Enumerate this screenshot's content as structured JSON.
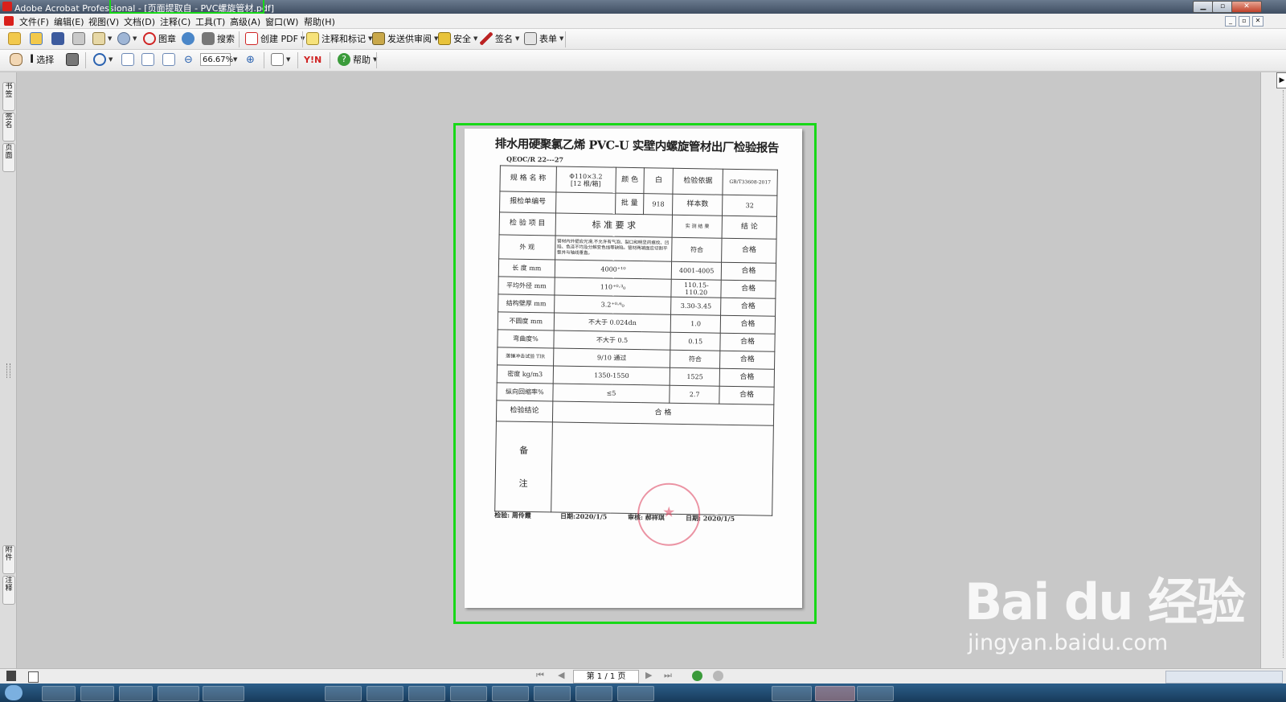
{
  "window": {
    "app_name": "Adobe Acrobat Professional",
    "title_rest": " - [页面提取自 - PVC螺旋管材.pdf]"
  },
  "menu": [
    "文件(F)",
    "编辑(E)",
    "视图(V)",
    "文档(D)",
    "注释(C)",
    "工具(T)",
    "高级(A)",
    "窗口(W)",
    "帮助(H)"
  ],
  "toolbar1": {
    "stamp_label": "图章",
    "search_label": "搜索",
    "create_pdf_label": "创建 PDF",
    "comment_label": "注释和标记",
    "send_review_label": "发送供审阅",
    "security_label": "安全",
    "sign_label": "签名",
    "forms_label": "表单"
  },
  "toolbar2": {
    "select_label": "选择",
    "zoom_value": "66.67%",
    "help_label": "帮助"
  },
  "nav_tabs": [
    "书签",
    "签名",
    "页面",
    "附件",
    "注释"
  ],
  "document": {
    "title": "排水用硬聚氯乙烯 PVC-U 实壁内螺旋管材出厂检验报告",
    "code": "QEOC/R 22---27",
    "spec_label": "规 格 名 称",
    "spec_value_1": "Φ110×3.2",
    "spec_value_2": "[12 根/箱]",
    "color_label": "颜 色",
    "color_value": "白",
    "basis_label": "检验依据",
    "basis_value": "GB/T33608-2017",
    "report_no_label": "报检单编号",
    "batch_label": "批 量",
    "batch_value": "918",
    "sample_label": "样本数",
    "sample_value": "32",
    "item_header": "检 验 项 目",
    "standard_header": "标 准 要 求",
    "result_header": "实 测 结 果",
    "conclusion_header": "结 论",
    "rows": [
      {
        "item": "外 观",
        "standard": "管材内外壁应光滑,不允许有气泡、裂口和明显的痕纹、凹陷、色泽不均及分解变色线等缺陷。管材两端面应切割平整并与轴线垂直。",
        "result": "符合",
        "conclusion": "合格"
      },
      {
        "item": "长 度 mm",
        "standard": "4000⁺¹⁰",
        "result": "4001-4005",
        "conclusion": "合格"
      },
      {
        "item": "平均外径 mm",
        "standard": "110⁺⁰·³₀",
        "result": "110.15-110.20",
        "conclusion": "合格"
      },
      {
        "item": "结构壁厚 mm",
        "standard": "3.2⁺⁰·⁶₀",
        "result": "3.30-3.45",
        "conclusion": "合格"
      },
      {
        "item": "不圆度 mm",
        "standard": "不大于 0.024dn",
        "result": "1.0",
        "conclusion": "合格"
      },
      {
        "item": "弯曲度%",
        "standard": "不大于 0.5",
        "result": "0.15",
        "conclusion": "合格"
      },
      {
        "item": "落锤冲击试验 TIR",
        "standard": "9/10 通过",
        "result": "符合",
        "conclusion": "合格"
      },
      {
        "item": "密度 kg/m3",
        "standard": "1350-1550",
        "result": "1525",
        "conclusion": "合格"
      },
      {
        "item": "纵向回缩率%",
        "standard": "≤5",
        "result": "2.7",
        "conclusion": "合格"
      }
    ],
    "final_label": "检验结论",
    "final_value": "合 格",
    "remark_char_1": "备",
    "remark_char_2": "注",
    "inspector": "检验: 周伶霞",
    "date1": "日期:2020/1/5",
    "reviewer": "审核: 郝祥琪",
    "date2": "日期: 2020/1/5"
  },
  "status": {
    "page_indicator": "第 1 / 1 页"
  },
  "watermark": {
    "brand": "Bai du 经验",
    "url": "jingyan.baidu.com"
  },
  "colors": {
    "highlight": "#18d818",
    "title_bar": "#3f4e62",
    "canvas": "#c8c8c8"
  }
}
